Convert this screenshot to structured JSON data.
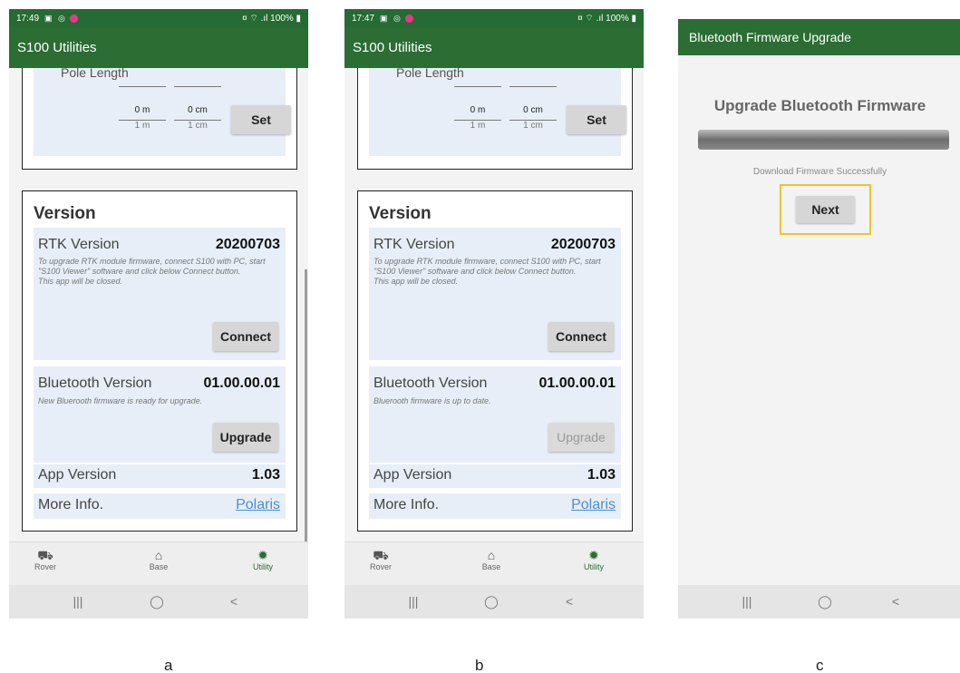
{
  "captions": [
    "a",
    "b",
    "c"
  ],
  "screens": [
    {
      "status": {
        "time": "17:49",
        "right": "100%"
      },
      "app_title": "S100 Utilities",
      "pole": {
        "title": "Pole Length",
        "m_value": "0 m",
        "cm_value": "0 cm",
        "m_unit": "1 m",
        "cm_unit": "1 cm",
        "set_label": "Set"
      },
      "version": {
        "title": "Version",
        "rtk_label": "RTK Version",
        "rtk_value": "20200703",
        "rtk_note": "To upgrade RTK module firmware, connect S100 with PC, start \"S100 Viewer\" software and click below Connect button.\nThis app will be closed.",
        "connect_label": "Connect",
        "bt_label": "Bluetooth Version",
        "bt_value": "01.00.00.01",
        "bt_note": "New Bluerooth firmware is ready for upgrade.",
        "upgrade_label": "Upgrade",
        "app_label": "App Version",
        "app_value": "1.03",
        "more_label": "More Info.",
        "more_link": "Polaris"
      },
      "tabs": [
        "Rover",
        "Base",
        "Utility"
      ],
      "upgrade_enabled": true
    },
    {
      "status": {
        "time": "17:47",
        "right": "100%"
      },
      "app_title": "S100 Utilities",
      "pole": {
        "title": "Pole Length",
        "m_value": "0 m",
        "cm_value": "0 cm",
        "m_unit": "1 m",
        "cm_unit": "1 cm",
        "set_label": "Set"
      },
      "version": {
        "title": "Version",
        "rtk_label": "RTK Version",
        "rtk_value": "20200703",
        "rtk_note": "To upgrade RTK module firmware, connect S100 with PC, start \"S100 Viewer\" software and click below Connect button.\nThis app will be closed.",
        "connect_label": "Connect",
        "bt_label": "Bluetooth Version",
        "bt_value": "01.00.00.01",
        "bt_note": "Bluerooth firmware is up to date.",
        "upgrade_label": "Upgrade",
        "app_label": "App Version",
        "app_value": "1.03",
        "more_label": "More Info.",
        "more_link": "Polaris"
      },
      "tabs": [
        "Rover",
        "Base",
        "Utility"
      ],
      "upgrade_enabled": false
    },
    {
      "app_title": "Bluetooth Firmware Upgrade",
      "heading": "Upgrade Bluetooth Firmware",
      "progress_fraction": 1.0,
      "message": "Download Firmware Successfully",
      "next_label": "Next"
    }
  ],
  "nav_glyphs": {
    "recent": "|||",
    "home": "◯",
    "back": "<"
  },
  "colors": {
    "appbar": "#2b6d33",
    "link": "#4a8fd4",
    "highlight": "#f2c12e"
  }
}
